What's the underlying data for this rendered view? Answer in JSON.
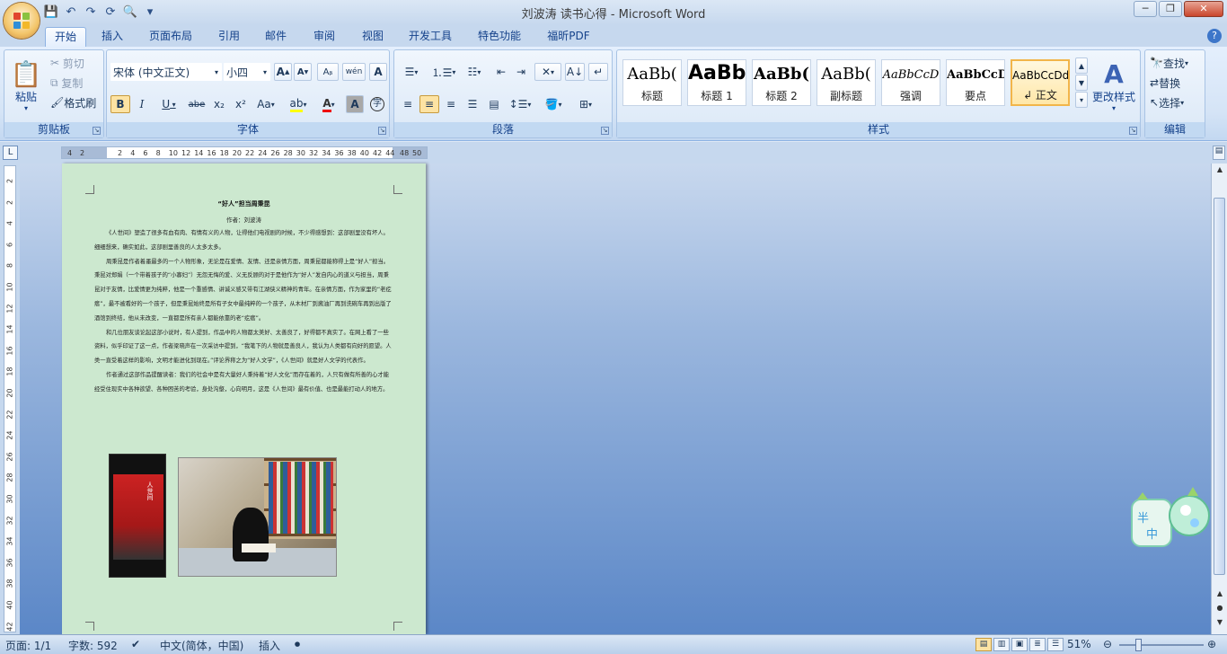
{
  "window": {
    "title": "刘波涛 读书心得 - Microsoft Word"
  },
  "quick_access": {
    "icons": [
      "save-icon",
      "undo-icon",
      "redo-icon",
      "repeat-icon",
      "print-preview-icon",
      "customize-icon"
    ]
  },
  "tabs": [
    "开始",
    "插入",
    "页面布局",
    "引用",
    "邮件",
    "审阅",
    "视图",
    "开发工具",
    "特色功能",
    "福昕PDF"
  ],
  "active_tab": "开始",
  "clipboard": {
    "paste": "粘贴",
    "cut": "剪切",
    "copy": "复制",
    "format_painter": "格式刷",
    "label": "剪贴板"
  },
  "font": {
    "name": "宋体 (中文正文)",
    "size": "小四",
    "label": "字体",
    "grow": "A",
    "shrink": "A",
    "bold": "B",
    "italic": "I",
    "underline": "U",
    "strike": "abe",
    "sub": "x₂",
    "sup": "x²",
    "case": "Aa",
    "color_a": "A",
    "char_shade": "A",
    "wen": "wén",
    "clear": "A"
  },
  "paragraph": {
    "label": "段落"
  },
  "styles": {
    "label": "样式",
    "items": [
      {
        "sample": "AaBb(",
        "name": "标题"
      },
      {
        "sample": "AaBb",
        "name": "标题 1"
      },
      {
        "sample": "AaBb(",
        "name": "标题 2"
      },
      {
        "sample": "AaBb(",
        "name": "副标题"
      },
      {
        "sample": "AaBbCcD",
        "name": "强调"
      },
      {
        "sample": "AaBbCcD",
        "name": "要点"
      },
      {
        "sample": "AaBbCcDd",
        "name": "↲ 正文"
      }
    ],
    "change": "更改样式"
  },
  "editing": {
    "label": "编辑",
    "find": "查找",
    "replace": "替换",
    "select": "选择"
  },
  "ruler": {
    "h_ticks": [
      "4",
      "2",
      "2",
      "4",
      "6",
      "8",
      "10",
      "12",
      "14",
      "16",
      "18",
      "20",
      "22",
      "24",
      "26",
      "28",
      "30",
      "32",
      "34",
      "36",
      "38",
      "40",
      "42",
      "44",
      "48",
      "50"
    ],
    "v_ticks": [
      "2",
      "2",
      "4",
      "6",
      "8",
      "10",
      "12",
      "14",
      "16",
      "18",
      "20",
      "22",
      "24",
      "26",
      "28",
      "30",
      "32",
      "34",
      "36",
      "38",
      "40",
      "42"
    ]
  },
  "document": {
    "title": "“好人”担当周秉昆",
    "author": "作者：刘波涛",
    "paragraphs": [
      "《人世间》塑造了很多有血有肉、有情有义的人物，让得他们电视剧的时候，不少得感想到：这部剧里没有坏人。细细想来，确实如此，这部剧里善良的人太多太多。",
      "周秉昆是作者着墨最多的一个人物形象，无论是在爱情、友情、还是亲情方面，周秉昆都能称得上是“好人”担当。秉昆对郑娟（一个带着孩子的“小寡妇”）无怨无悔的爱、义无反顾的对于是他作为“好人”发自内心的道义与担当，周秉昆对于友情，比爱情更为纯粹，他是一个重感情、讲诚义感又带有江湖侠义精神的青年。在亲情方面，作为家里的“老疙瘩”，最不被看好的一个孩子，但是秉昆始终是所有子女中最纯粹的一个孩子，从木材厂到酱油厂再到洗碗车再到出版了酒馆到终结，他从未改变，一直都是所有亲人都能依靠的老“疙瘩”。",
      "和几位朋友谈论起这部小说时，有人提到，作品中的人物都太美好、太善良了，好得都不真实了。在网上看了一些资料，似乎印证了这一点，作者梁晓声在一次采访中提到，“我笔下的人物就是善良人，我认为人类都有向好的愿望。人类一直受着这样的影响，文明才能进化到现在。”评论界称之为“好人文学”，《人世间》就是好人文学的代表作。",
      "作者通过这部作品提醒读者：我们的社会中是有大量好人秉持着“好人文化”而存在着的，人只有做有所善的心才能经受住现实中各种欲望、各种困苦的考验，身处沟壑，心向明月，这是《人世间》最有价值、也是最能打动人的地方。"
    ],
    "image1_text": "人世间"
  },
  "statusbar": {
    "page": "页面: 1/1",
    "words": "字数: 592",
    "lang": "中文(简体，中国)",
    "mode": "插入",
    "zoom": "51%"
  },
  "mascot": {
    "text1": "半",
    "text2": "中"
  },
  "colors": {
    "page_bg": "#cce8cf",
    "ribbon_text": "#15428b",
    "doc_bg_bottom": "#5b87c7"
  }
}
